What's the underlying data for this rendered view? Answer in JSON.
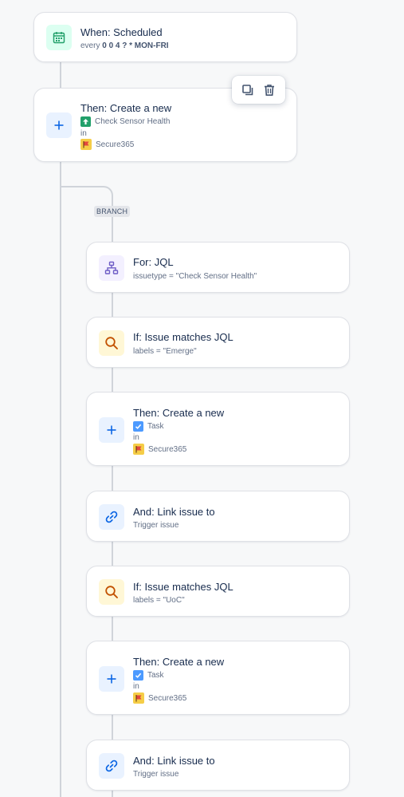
{
  "trigger": {
    "title": "When: Scheduled",
    "every": "every",
    "cron": "0 0 4 ? * MON-FRI"
  },
  "create1": {
    "title": "Then: Create a new",
    "issue_type": "Check Sensor Health",
    "in": "in",
    "project": "Secure365"
  },
  "toolbar": {
    "duplicate_icon": "duplicate-icon",
    "delete_icon": "trash-icon"
  },
  "branch": {
    "label": "BRANCH"
  },
  "for_jql": {
    "title": "For: JQL",
    "query": "issuetype = \"Check Sensor Health\""
  },
  "if1": {
    "title": "If: Issue matches JQL",
    "query": "labels = \"Emerge\""
  },
  "create2": {
    "title": "Then: Create a new",
    "issue_type": "Task",
    "in": "in",
    "project": "Secure365"
  },
  "link1": {
    "title": "And: Link issue to",
    "target": "Trigger issue"
  },
  "if2": {
    "title": "If: Issue matches JQL",
    "query": "labels = \"UoC\""
  },
  "create3": {
    "title": "Then: Create a new",
    "issue_type": "Task",
    "in": "in",
    "project": "Secure365"
  },
  "link2": {
    "title": "And: Link issue to",
    "target": "Trigger issue"
  },
  "colors": {
    "green": "#22a06b",
    "blue": "#0c66e4",
    "purple": "#6e5dc6",
    "orange": "#c25100",
    "accent_yellow": "#f5cd47"
  }
}
